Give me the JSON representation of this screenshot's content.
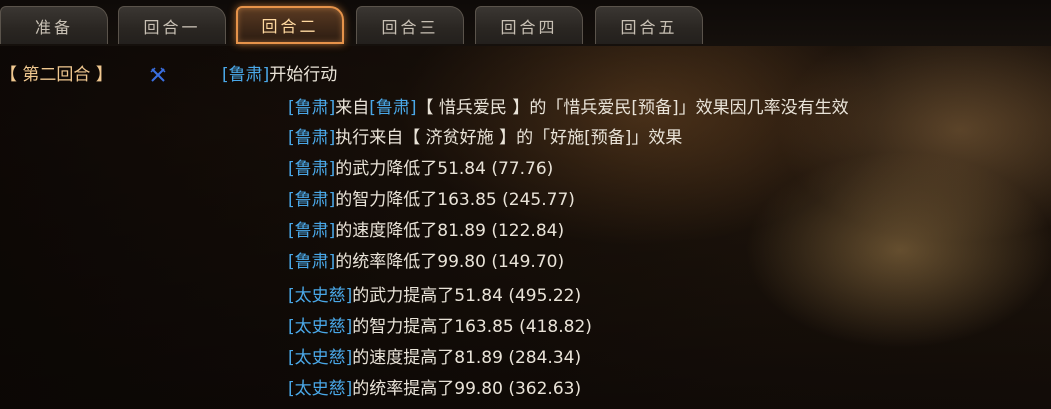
{
  "tabs": [
    {
      "label": "准备",
      "active": false
    },
    {
      "label": "回合一",
      "active": false
    },
    {
      "label": "回合二",
      "active": true
    },
    {
      "label": "回合三",
      "active": false
    },
    {
      "label": "回合四",
      "active": false
    },
    {
      "label": "回合五",
      "active": false
    }
  ],
  "log": {
    "round_label": "【 第二回合 】",
    "status_icon": "crossed-swords-icon",
    "action_line": {
      "name": "[鲁肃]",
      "text": "开始行动"
    },
    "entries": [
      {
        "name": "[鲁肃]",
        "text_parts": [
          "来自",
          "[鲁肃]",
          "【 惜兵爱民 】的「惜兵爱民[预备]」效果因几率没有生效"
        ]
      },
      {
        "name": "[鲁肃]",
        "text": "执行来自【 济贫好施 】的「好施[预备]」效果"
      },
      {
        "name": "[鲁肃]",
        "text": "的武力降低了51.84 (77.76)"
      },
      {
        "name": "[鲁肃]",
        "text": "的智力降低了163.85 (245.77)"
      },
      {
        "name": "[鲁肃]",
        "text": "的速度降低了81.89 (122.84)"
      },
      {
        "name": "[鲁肃]",
        "text": "的统率降低了99.80 (149.70)"
      },
      {
        "name": "[太史慈]",
        "text": "的武力提高了51.84 (495.22)"
      },
      {
        "name": "[太史慈]",
        "text": "的智力提高了163.85 (418.82)"
      },
      {
        "name": "[太史慈]",
        "text": "的速度提高了81.89 (284.34)"
      },
      {
        "name": "[太史慈]",
        "text": "的统率提高了99.80 (362.63)"
      }
    ]
  },
  "colors": {
    "name": "#4aa8e8",
    "text": "#e9e3d8",
    "round_label": "#f0c890",
    "active_tab_border": "#e6934a"
  }
}
